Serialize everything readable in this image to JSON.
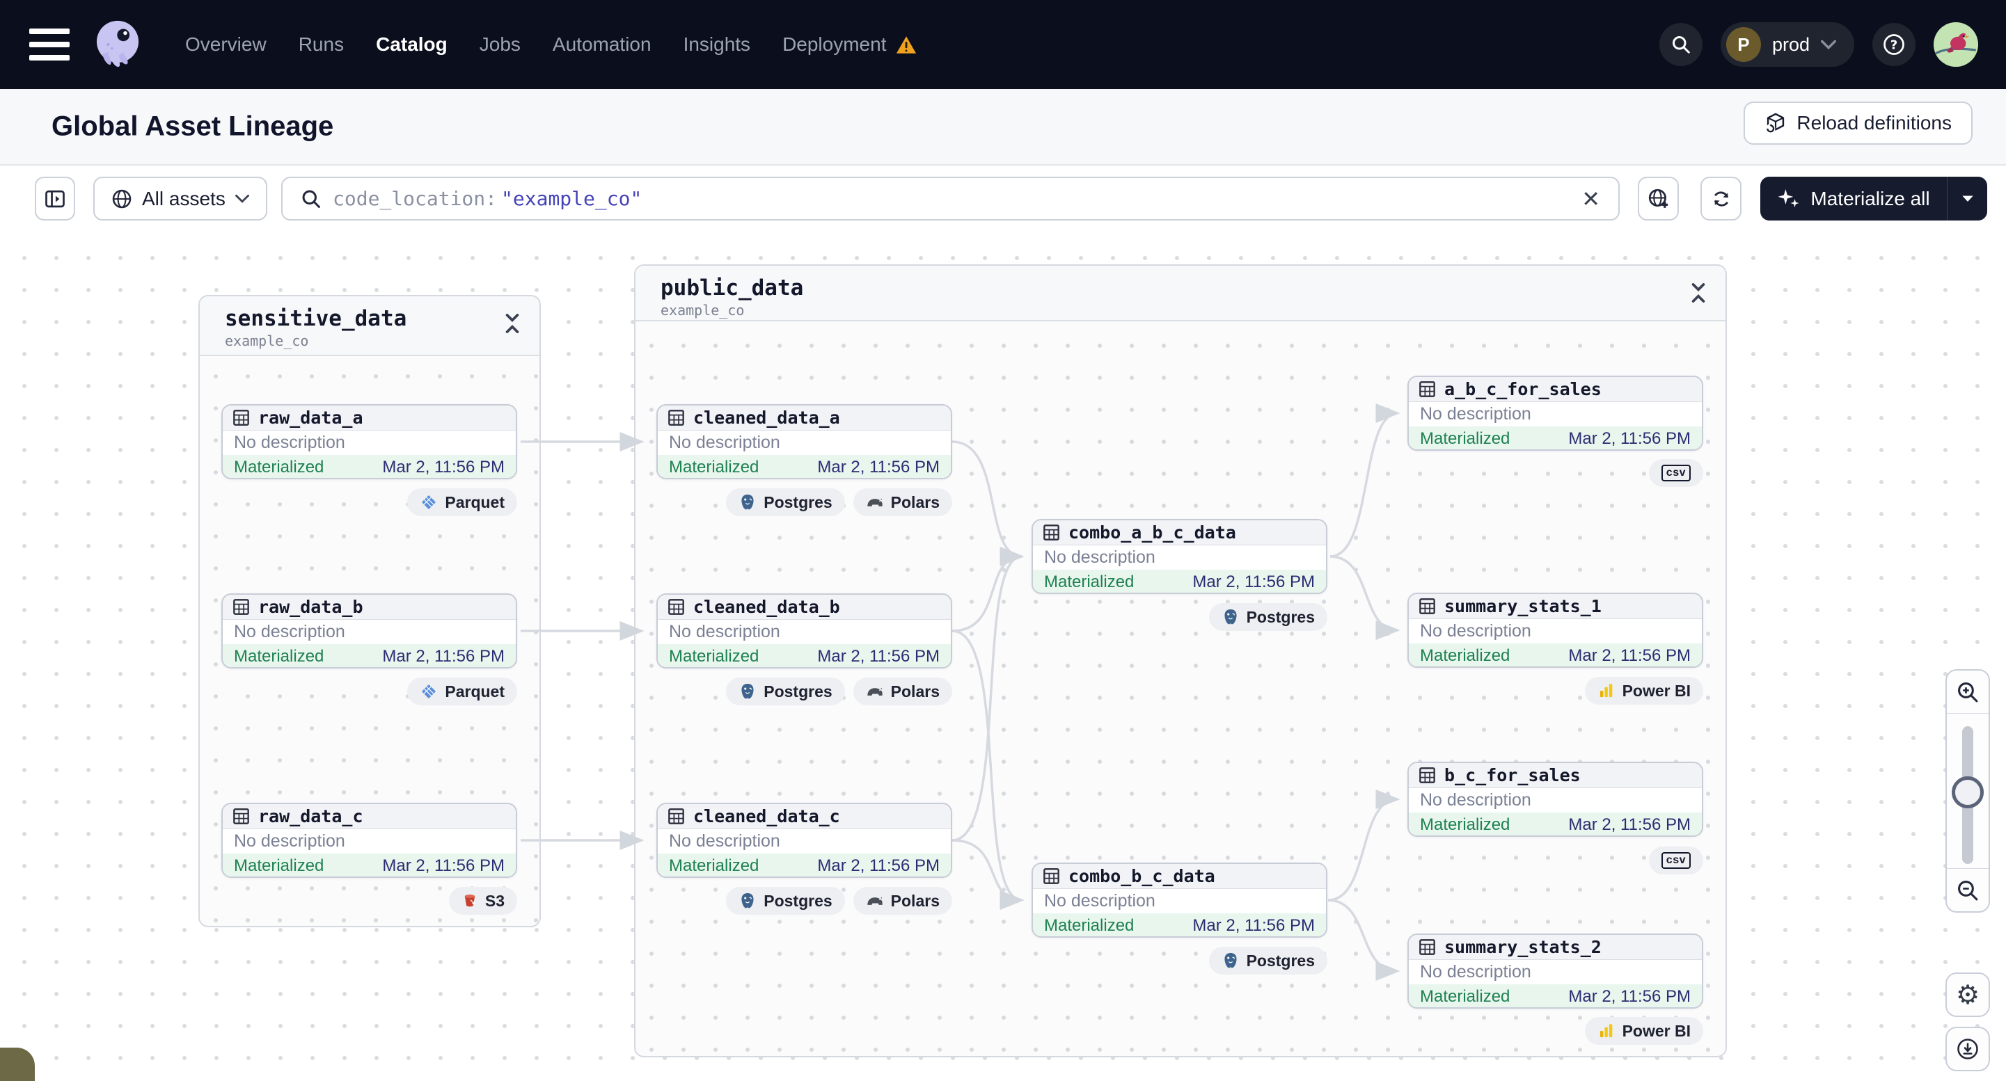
{
  "nav": {
    "items": [
      {
        "label": "Overview"
      },
      {
        "label": "Runs"
      },
      {
        "label": "Catalog"
      },
      {
        "label": "Jobs"
      },
      {
        "label": "Automation"
      },
      {
        "label": "Insights"
      },
      {
        "label": "Deployment"
      }
    ],
    "active_item": "Catalog",
    "user": {
      "initial": "P",
      "name": "prod"
    }
  },
  "header": {
    "title": "Global Asset Lineage",
    "reload_label": "Reload definitions"
  },
  "filterbar": {
    "scope_label": "All assets",
    "search_prefix": "code_location:",
    "search_value": "\"example_co\"",
    "materialize_label": "Materialize all"
  },
  "canvas": {
    "groups": [
      {
        "name": "sensitive_data",
        "location": "example_co"
      },
      {
        "name": "public_data",
        "location": "example_co"
      }
    ],
    "nodes": [
      {
        "name": "raw_data_a",
        "description": "No description",
        "status": "Materialized",
        "timestamp": "Mar 2, 11:56 PM",
        "tags": [
          {
            "label": "Parquet"
          }
        ]
      },
      {
        "name": "raw_data_b",
        "description": "No description",
        "status": "Materialized",
        "timestamp": "Mar 2, 11:56 PM",
        "tags": [
          {
            "label": "Parquet"
          }
        ]
      },
      {
        "name": "raw_data_c",
        "description": "No description",
        "status": "Materialized",
        "timestamp": "Mar 2, 11:56 PM",
        "tags": [
          {
            "label": "S3"
          }
        ]
      },
      {
        "name": "cleaned_data_a",
        "description": "No description",
        "status": "Materialized",
        "timestamp": "Mar 2, 11:56 PM",
        "tags": [
          {
            "label": "Postgres"
          },
          {
            "label": "Polars"
          }
        ]
      },
      {
        "name": "cleaned_data_b",
        "description": "No description",
        "status": "Materialized",
        "timestamp": "Mar 2, 11:56 PM",
        "tags": [
          {
            "label": "Postgres"
          },
          {
            "label": "Polars"
          }
        ]
      },
      {
        "name": "cleaned_data_c",
        "description": "No description",
        "status": "Materialized",
        "timestamp": "Mar 2, 11:56 PM",
        "tags": [
          {
            "label": "Postgres"
          },
          {
            "label": "Polars"
          }
        ]
      },
      {
        "name": "combo_a_b_c_data",
        "description": "No description",
        "status": "Materialized",
        "timestamp": "Mar 2, 11:56 PM",
        "tags": [
          {
            "label": "Postgres"
          }
        ]
      },
      {
        "name": "combo_b_c_data",
        "description": "No description",
        "status": "Materialized",
        "timestamp": "Mar 2, 11:56 PM",
        "tags": [
          {
            "label": "Postgres"
          }
        ]
      },
      {
        "name": "a_b_c_for_sales",
        "description": "No description",
        "status": "Materialized",
        "timestamp": "Mar 2, 11:56 PM",
        "tags": [
          {
            "label": "csv"
          }
        ]
      },
      {
        "name": "summary_stats_1",
        "description": "No description",
        "status": "Materialized",
        "timestamp": "Mar 2, 11:56 PM",
        "tags": [
          {
            "label": "Power BI"
          }
        ]
      },
      {
        "name": "b_c_for_sales",
        "description": "No description",
        "status": "Materialized",
        "timestamp": "Mar 2, 11:56 PM",
        "tags": [
          {
            "label": "csv"
          }
        ]
      },
      {
        "name": "summary_stats_2",
        "description": "No description",
        "status": "Materialized",
        "timestamp": "Mar 2, 11:56 PM",
        "tags": [
          {
            "label": "Power BI"
          }
        ]
      }
    ]
  },
  "colors": {
    "navbar_bg": "#0B0E1C",
    "search_value_blue": "#4442B8",
    "status_green": "#1E8150",
    "status_row_bg": "#E9F6EE",
    "timestamp_navy": "#2B2D72",
    "warning_orange": "#F0A21F",
    "materialize_bg": "#161B2E",
    "edge_gray": "#D6D9DF"
  }
}
